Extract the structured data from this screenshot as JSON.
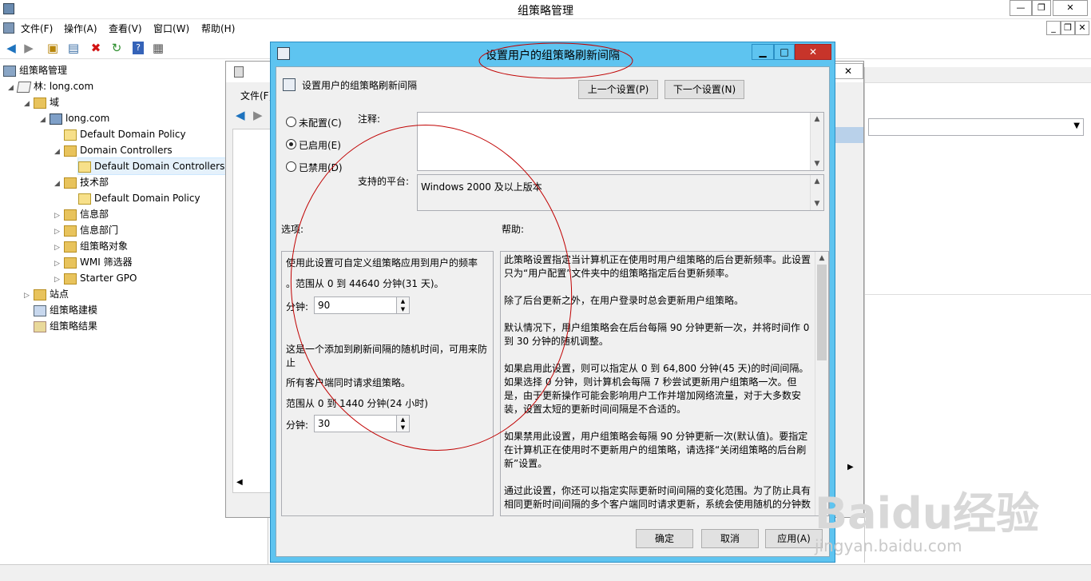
{
  "window": {
    "title": "组策略管理",
    "min": "—",
    "max": "❐",
    "close": "✕",
    "inner_min": "_",
    "inner_max": "❐",
    "inner_close": "✕"
  },
  "menu": [
    "文件(F)",
    "操作(A)",
    "查看(V)",
    "窗口(W)",
    "帮助(H)"
  ],
  "tree": {
    "root": "组策略管理",
    "forest": "林: long.com",
    "domains": "域",
    "domain": "long.com",
    "ddp": "Default Domain Policy",
    "dc_ou": "Domain Controllers",
    "ddcp": "Default Domain Controllers",
    "tech": "技术部",
    "tech_ddp": "Default Domain Policy",
    "info": "信息部",
    "info2": "信息部门",
    "gpo": "组策略对象",
    "wmi": "WMI 筛选器",
    "starter": "Starter GPO",
    "sites": "站点",
    "modeling": "组策略建模",
    "results": "组策略结果"
  },
  "bgwin": {
    "menu_file": "文件(F)",
    "close": "✕"
  },
  "dialog": {
    "title": "设置用户的组策略刷新间隔",
    "setting_name": "设置用户的组策略刷新间隔",
    "prev": "上一个设置(P)",
    "next": "下一个设置(N)",
    "radio_not_configured": "未配置(C)",
    "radio_enabled": "已启用(E)",
    "radio_disabled": "已禁用(D)",
    "comment_label": "注释:",
    "platform_label": "支持的平台:",
    "platform_value": "Windows 2000 及以上版本",
    "options_label": "选项:",
    "help_label": "帮助:",
    "opt_line1": "使用此设置可自定义组策略应用到用户的频率",
    "opt_line2": "。范围从 0 到 44640 分钟(31 天)。",
    "minutes_label1": "分钟:",
    "minutes_value1": "90",
    "opt_line3": "这是一个添加到刷新间隔的随机时间，可用来防止",
    "opt_line4": "所有客户端同时请求组策略。",
    "opt_line5": "范围从 0 到 1440 分钟(24 小时)",
    "minutes_label2": "分钟:",
    "minutes_value2": "30",
    "help": [
      "此策略设置指定当计算机正在使用时用户组策略的后台更新频率。此设置只为“用户配置”文件夹中的组策略指定后台更新频率。",
      "除了后台更新之外，在用户登录时总会更新用户组策略。",
      "默认情况下，用户组策略会在后台每隔 90 分钟更新一次，并将时间作 0 到 30 分钟的随机调整。",
      "如果启用此设置，则可以指定从 0 到 64,800 分钟(45 天)的时间间隔。如果选择 0 分钟，则计算机会每隔 7 秒尝试更新用户组策略一次。但是，由于更新操作可能会影响用户工作并增加网络流量，对于大多数安装，设置太短的更新时间间隔是不合适的。",
      "如果禁用此设置，用户组策略会每隔 90 分钟更新一次(默认值)。要指定在计算机正在使用时不更新用户的组策略，请选择“关闭组策略的后台刷新”设置。",
      "通过此设置，你还可以指定实际更新时间间隔的变化范围。为了防止具有相同更新时间间隔的多个客户端同时请求更新，系统会使用随机的分钟数"
    ],
    "ok": "确定",
    "cancel": "取消",
    "apply": "应用(A)"
  },
  "watermark": {
    "brand": "Baidu经验",
    "url": "jingyan.baidu.com"
  },
  "colors": {
    "dialog_frame": "#5ec4f0",
    "annotation": "#c00000"
  }
}
